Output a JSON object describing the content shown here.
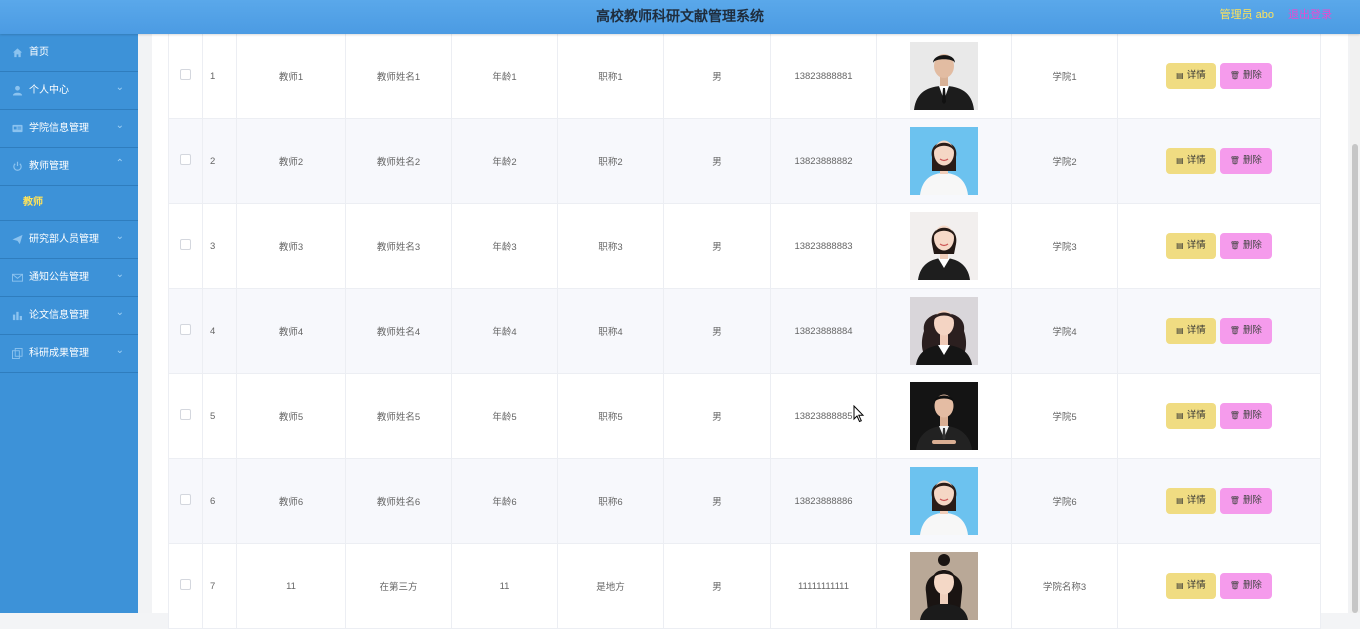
{
  "header": {
    "title": "高校教师科研文献管理系统",
    "admin": "管理员 abo",
    "logout": "退出登录"
  },
  "sidebar": {
    "items": [
      {
        "label": "首页",
        "icon": "home-icon",
        "chevron": false
      },
      {
        "label": "个人中心",
        "icon": "user-icon",
        "chevron": true
      },
      {
        "label": "学院信息管理",
        "icon": "id-card-icon",
        "chevron": true
      },
      {
        "label": "教师管理",
        "icon": "power-icon",
        "chevron": true,
        "expanded": true
      },
      {
        "label": "研究部人员管理",
        "icon": "paper-plane-icon",
        "chevron": true
      },
      {
        "label": "通知公告管理",
        "icon": "envelope-icon",
        "chevron": true
      },
      {
        "label": "论文信息管理",
        "icon": "chart-icon",
        "chevron": true
      },
      {
        "label": "科研成果管理",
        "icon": "copy-icon",
        "chevron": true
      }
    ],
    "submenu": {
      "label": "教师",
      "active": true
    }
  },
  "table": {
    "rows": [
      {
        "index": "1",
        "account": "教师1",
        "name": "教师姓名1",
        "age": "年龄1",
        "title": "职称1",
        "gender": "男",
        "phone": "13823888881",
        "photo": "man-dark-suit",
        "college": "学院1"
      },
      {
        "index": "2",
        "account": "教师2",
        "name": "教师姓名2",
        "age": "年龄2",
        "title": "职称2",
        "gender": "男",
        "phone": "13823888882",
        "photo": "woman-blue-bg",
        "college": "学院2"
      },
      {
        "index": "3",
        "account": "教师3",
        "name": "教师姓名3",
        "age": "年龄3",
        "title": "职称3",
        "gender": "男",
        "phone": "13823888883",
        "photo": "woman-white-bg",
        "college": "学院3"
      },
      {
        "index": "4",
        "account": "教师4",
        "name": "教师姓名4",
        "age": "年龄4",
        "title": "职称4",
        "gender": "男",
        "phone": "13823888884",
        "photo": "woman-curly-hair",
        "college": "学院4"
      },
      {
        "index": "5",
        "account": "教师5",
        "name": "教师姓名5",
        "age": "年龄5",
        "title": "职称5",
        "gender": "男",
        "phone": "13823888885",
        "photo": "man-dark-bg",
        "college": "学院5"
      },
      {
        "index": "6",
        "account": "教师6",
        "name": "教师姓名6",
        "age": "年龄6",
        "title": "职称6",
        "gender": "男",
        "phone": "13823888886",
        "photo": "woman-blue-bg",
        "college": "学院6"
      },
      {
        "index": "7",
        "account": "11",
        "name": "在第三方",
        "age": "11",
        "title": "是地方",
        "gender": "男",
        "phone": "11111111111",
        "photo": "girl-portrait",
        "college": "学院名称3"
      }
    ],
    "actions": {
      "detail": "详情",
      "delete": "删除"
    }
  },
  "colors": {
    "header": "#4b9be3",
    "sidebar": "#3d92d8",
    "detail_button": "#f0dc82",
    "delete_button": "#f59bec",
    "active_submenu": "#ffe35a"
  }
}
